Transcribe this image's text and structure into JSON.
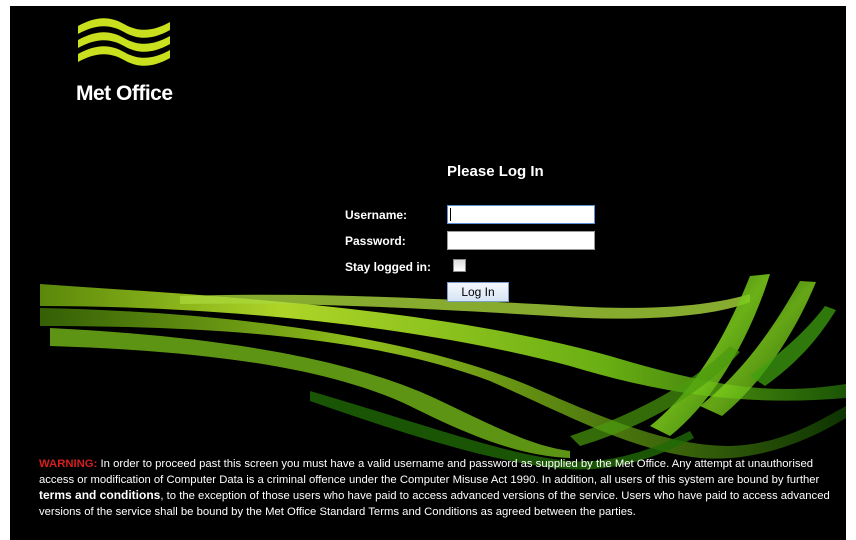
{
  "brand": {
    "name": "Met Office",
    "colors": {
      "background": "#000000",
      "ribbon_green": "#9acd1f",
      "logo_green": "#c8e01e",
      "warning_red": "#d61f1f"
    }
  },
  "login": {
    "title": "Please Log In",
    "username_label": "Username:",
    "username_value": "",
    "password_label": "Password:",
    "password_value": "",
    "stay_logged_in_label": "Stay logged in:",
    "stay_logged_in_checked": false,
    "submit_label": "Log In"
  },
  "warning": {
    "label": "WARNING:",
    "text_part1": " In order to proceed past this screen you must have a valid username and password as supplied by the Met Office. Any attempt at unauthorised access or modification of Computer Data is a criminal offence under the Computer Misuse Act 1990. In addition, all users of this system are bound by further ",
    "terms_link": "terms and conditions",
    "text_part2": ", to the exception of those users who have paid to access advanced versions of the service. Users who have paid to access advanced versions of the service shall be bound by the Met Office Standard Terms and Conditions as agreed between the parties."
  }
}
